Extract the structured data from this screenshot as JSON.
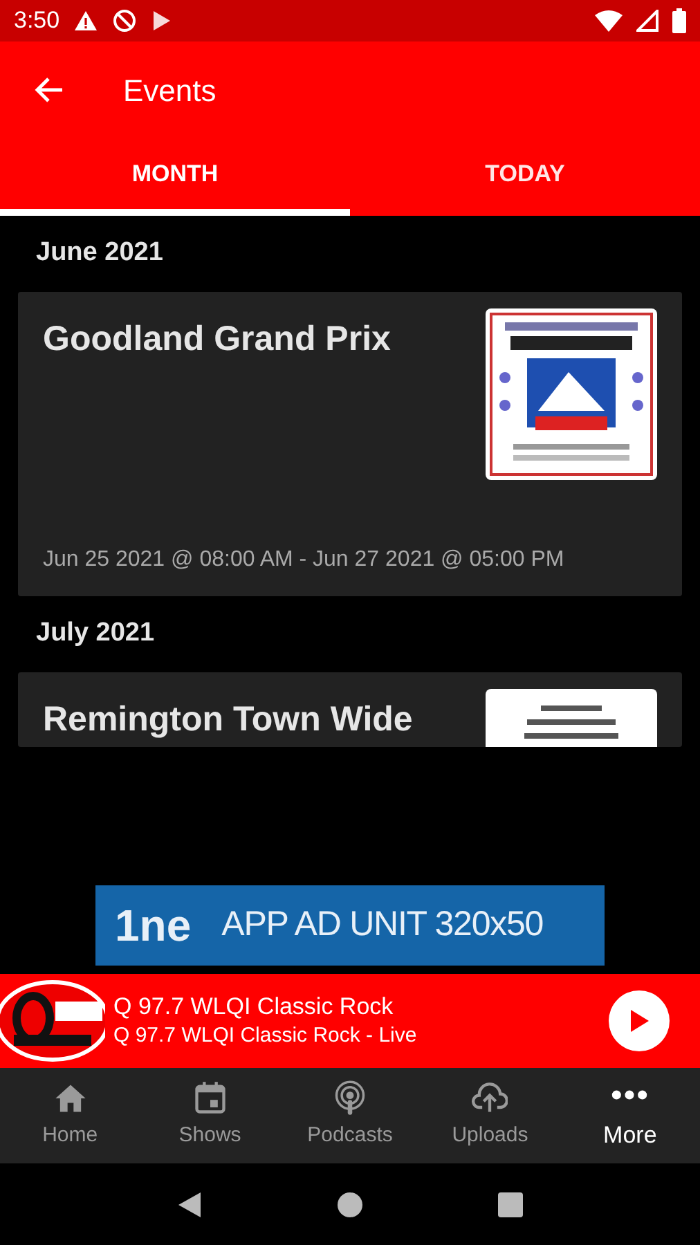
{
  "status_bar": {
    "time": "3:50"
  },
  "app_bar": {
    "title": "Events"
  },
  "tabs": [
    {
      "label": "MONTH",
      "selected": true
    },
    {
      "label": "TODAY",
      "selected": false
    }
  ],
  "sections": [
    {
      "heading": "June 2021",
      "events": [
        {
          "title": "Goodland Grand Prix",
          "dates": "Jun 25 2021 @ 08:00 AM - Jun 27 2021 @ 05:00 PM"
        }
      ]
    },
    {
      "heading": "July 2021",
      "events": [
        {
          "title": "Remington Town Wide"
        }
      ]
    }
  ],
  "ad": {
    "logo": "1ne",
    "text": "APP AD UNIT 320x50"
  },
  "player": {
    "title": "Q 97.7 WLQI Classic Rock",
    "subtitle": "Q 97.7 WLQI Classic Rock - Live"
  },
  "bottom_nav": [
    {
      "label": "Home",
      "kind": "home",
      "selected": false
    },
    {
      "label": "Shows",
      "kind": "calendar",
      "selected": false
    },
    {
      "label": "Podcasts",
      "kind": "podcast",
      "selected": false
    },
    {
      "label": "Uploads",
      "kind": "upload",
      "selected": false
    },
    {
      "label": "More",
      "kind": "more",
      "selected": true
    }
  ]
}
